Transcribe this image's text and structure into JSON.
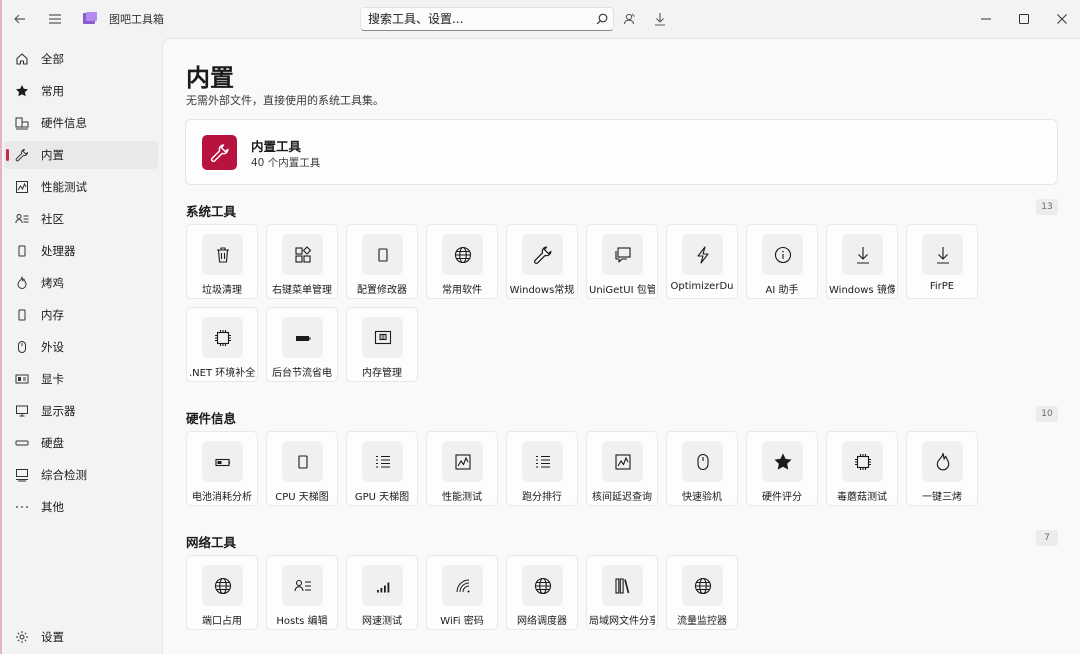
{
  "app": {
    "title": "图吧工具箱"
  },
  "search": {
    "placeholder": "搜索工具、设置..."
  },
  "sidebar": {
    "items": [
      {
        "label": "全部",
        "icon": "home-icon"
      },
      {
        "label": "常用",
        "icon": "star-icon"
      },
      {
        "label": "硬件信息",
        "icon": "hardware-icon"
      },
      {
        "label": "内置",
        "icon": "wrench-icon",
        "active": true
      },
      {
        "label": "性能测试",
        "icon": "chart-icon"
      },
      {
        "label": "社区",
        "icon": "community-icon"
      },
      {
        "label": "处理器",
        "icon": "cpu-icon"
      },
      {
        "label": "烤鸡",
        "icon": "fire-icon"
      },
      {
        "label": "内存",
        "icon": "memory-icon"
      },
      {
        "label": "外设",
        "icon": "mouse-icon"
      },
      {
        "label": "显卡",
        "icon": "gpu-icon"
      },
      {
        "label": "显示器",
        "icon": "monitor-icon"
      },
      {
        "label": "硬盘",
        "icon": "disk-icon"
      },
      {
        "label": "综合检测",
        "icon": "pc-icon"
      },
      {
        "label": "其他",
        "icon": "more-icon"
      }
    ],
    "settings_label": "设置"
  },
  "main": {
    "title": "内置",
    "subtitle": "无需外部文件，直接使用的系统工具集。",
    "card": {
      "title": "内置工具",
      "subtitle": "40 个内置工具"
    },
    "sections": [
      {
        "title": "系统工具",
        "count": "13",
        "tiles": [
          {
            "label": "垃圾清理",
            "icon": "trash-icon"
          },
          {
            "label": "右键菜单管理",
            "icon": "apps-icon"
          },
          {
            "label": "配置修改器",
            "icon": "phone-icon"
          },
          {
            "label": "常用软件",
            "icon": "globe-icon"
          },
          {
            "label": "Windows常规",
            "icon": "wrench-icon"
          },
          {
            "label": "UniGetUI 包管",
            "icon": "chat-icon"
          },
          {
            "label": "OptimizerDu",
            "icon": "bolt-icon"
          },
          {
            "label": "AI 助手",
            "icon": "info-icon"
          },
          {
            "label": "Windows 镜像",
            "icon": "download-icon"
          },
          {
            "label": "FirPE",
            "icon": "download-icon"
          },
          {
            "label": ".NET 环境补全",
            "icon": "chip-icon"
          },
          {
            "label": "后台节流省电",
            "icon": "battery-icon"
          },
          {
            "label": "内存管理",
            "icon": "memory-board-icon"
          }
        ]
      },
      {
        "title": "硬件信息",
        "count": "10",
        "tiles": [
          {
            "label": "电池消耗分析",
            "icon": "battery-low-icon"
          },
          {
            "label": "CPU 天梯图",
            "icon": "phone-icon"
          },
          {
            "label": "GPU 天梯图",
            "icon": "list-icon"
          },
          {
            "label": "性能测试",
            "icon": "chart-icon"
          },
          {
            "label": "跑分排行",
            "icon": "list-icon"
          },
          {
            "label": "核间延迟查询",
            "icon": "chart-icon"
          },
          {
            "label": "快速验机",
            "icon": "mouse-icon"
          },
          {
            "label": "硬件评分",
            "icon": "star-icon"
          },
          {
            "label": "毒蘑菇测试",
            "icon": "chip-icon"
          },
          {
            "label": "一键三烤",
            "icon": "fire-icon"
          }
        ]
      },
      {
        "title": "网络工具",
        "count": "7",
        "tiles": [
          {
            "label": "端口占用",
            "icon": "globe-icon"
          },
          {
            "label": "Hosts 编辑",
            "icon": "community-icon"
          },
          {
            "label": "网速测试",
            "icon": "signal-icon"
          },
          {
            "label": "WiFi 密码",
            "icon": "wifi-icon"
          },
          {
            "label": "网络调度器",
            "icon": "globe-icon"
          },
          {
            "label": "局域网文件分享",
            "icon": "books-icon"
          },
          {
            "label": "流量监控器",
            "icon": "globe-icon"
          }
        ]
      }
    ]
  },
  "colors": {
    "accent": "#b8123f",
    "indicator": "#c42b4e"
  }
}
